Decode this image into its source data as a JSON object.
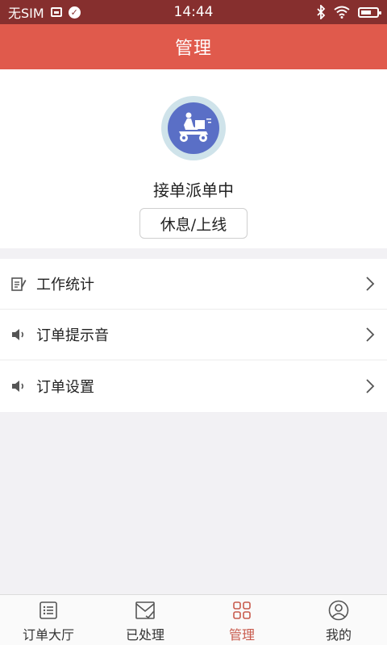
{
  "status_bar": {
    "carrier": "无SIM",
    "time": "14:44"
  },
  "header": {
    "title": "管理"
  },
  "profile": {
    "status_text": "接单派单中",
    "toggle_label": "休息/上线"
  },
  "menu": {
    "items": [
      {
        "label": "工作统计",
        "icon": "edit-list-icon"
      },
      {
        "label": "订单提示音",
        "icon": "speaker-icon"
      },
      {
        "label": "订单设置",
        "icon": "speaker-icon"
      }
    ]
  },
  "bottom_nav": {
    "items": [
      {
        "label": "订单大厅",
        "icon": "list-icon"
      },
      {
        "label": "已处理",
        "icon": "mail-check-icon"
      },
      {
        "label": "管理",
        "icon": "grid-icon"
      },
      {
        "label": "我的",
        "icon": "user-icon"
      }
    ],
    "active": "管理"
  },
  "colors": {
    "status_bar": "#862f2e",
    "header": "#e05a4c",
    "active_nav": "#c85a4c",
    "avatar_bg": "#5a6fc6"
  }
}
